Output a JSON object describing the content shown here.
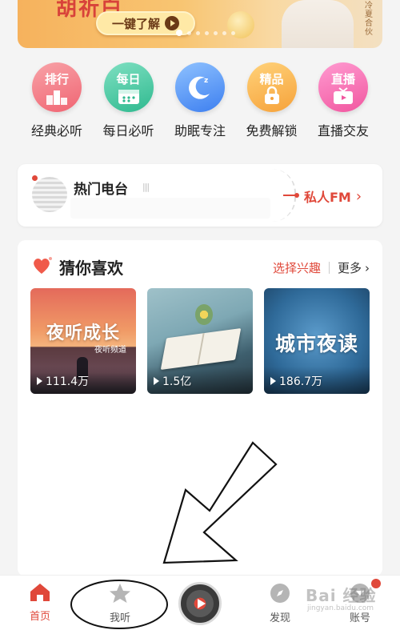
{
  "banner": {
    "cutoff_text": "胡祈白",
    "button_label": "一键了解",
    "side_text": "冷夏合伙",
    "dots_count": 7,
    "active_dot": 0
  },
  "quick": [
    {
      "tag": "排行",
      "label": "经典必听",
      "color_from": "#f8a3a8",
      "color_to": "#f06472",
      "icon": "podium-icon"
    },
    {
      "tag": "每日",
      "label": "每日必听",
      "color_from": "#7fe0c2",
      "color_to": "#2fb98f",
      "icon": "calendar-icon"
    },
    {
      "tag": "",
      "label": "助眠专注",
      "color_from": "#8fc2ff",
      "color_to": "#3d7ff0",
      "icon": "moon-icon"
    },
    {
      "tag": "精品",
      "label": "免费解锁",
      "color_from": "#ffd27a",
      "color_to": "#f6a23a",
      "icon": "lock-icon"
    },
    {
      "tag": "直播",
      "label": "直播交友",
      "color_from": "#ff9bd1",
      "color_to": "#f1569f",
      "icon": "tv-icon"
    }
  ],
  "radio": {
    "title": "热门电台",
    "bars": "|||",
    "fm_label": "私人FM",
    "chevron": "›"
  },
  "guess": {
    "title": "猜你喜欢",
    "interest_label": "选择兴趣",
    "more_label": "更多",
    "chevron": "›",
    "cards": [
      {
        "title": "夜听成长",
        "subtitle": "夜听频道",
        "count": "111.4万"
      },
      {
        "title": "",
        "subtitle": "",
        "count": "1.5亿"
      },
      {
        "title": "城市夜读",
        "subtitle": "",
        "count": "186.7万"
      }
    ]
  },
  "nav": {
    "items": [
      {
        "label": "首页",
        "icon": "home-icon",
        "active": true
      },
      {
        "label": "我听",
        "icon": "star-icon",
        "active": false
      },
      {
        "label": "发现",
        "icon": "compass-icon",
        "active": false
      },
      {
        "label": "账号",
        "icon": "account-icon",
        "active": false
      }
    ],
    "accent": "#e0483a"
  },
  "watermark": {
    "text": "Bai 经验",
    "sub": "jingyan.baidu.com"
  }
}
